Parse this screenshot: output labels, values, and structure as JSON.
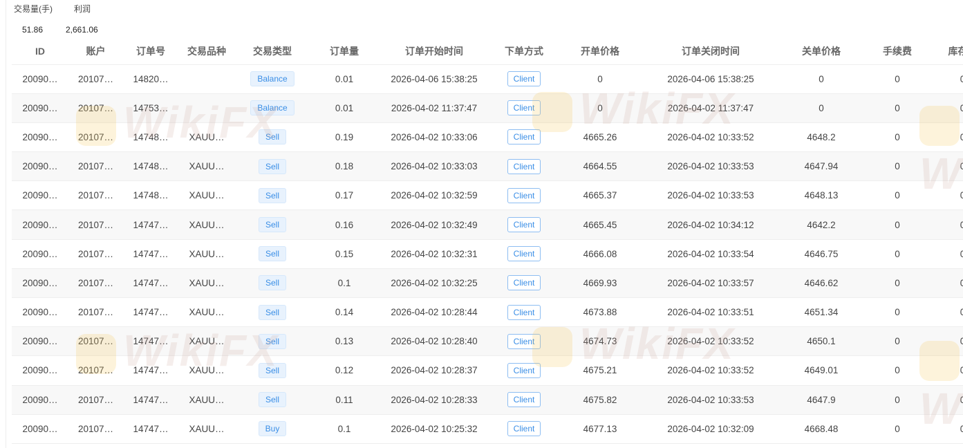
{
  "summary": {
    "labels": [
      "交易量(手)",
      "利润"
    ],
    "values": [
      "51.86",
      "2,661.06"
    ]
  },
  "watermark": "WikiFX",
  "columns": [
    "ID",
    "账户",
    "订单号",
    "交易品种",
    "交易类型",
    "订单量",
    "订单开始时间",
    "下单方式",
    "开单价格",
    "订单关闭时间",
    "关单价格",
    "手续费",
    "库存费"
  ],
  "rows": [
    [
      "20090…",
      "20107…",
      "14820…",
      "",
      "Balance",
      "0.01",
      "2026-04-06 15:38:25",
      "Client",
      "0",
      "2026-04-06 15:38:25",
      "0",
      "0",
      "0"
    ],
    [
      "20090…",
      "20107…",
      "14753…",
      "",
      "Balance",
      "0.01",
      "2026-04-02 11:37:47",
      "Client",
      "0",
      "2026-04-02 11:37:47",
      "0",
      "0",
      "0"
    ],
    [
      "20090…",
      "20107…",
      "14748…",
      "XAUU…",
      "Sell",
      "0.19",
      "2026-04-02 10:33:06",
      "Client",
      "4665.26",
      "2026-04-02 10:33:52",
      "4648.2",
      "0",
      "0"
    ],
    [
      "20090…",
      "20107…",
      "14748…",
      "XAUU…",
      "Sell",
      "0.18",
      "2026-04-02 10:33:03",
      "Client",
      "4664.55",
      "2026-04-02 10:33:53",
      "4647.94",
      "0",
      "0"
    ],
    [
      "20090…",
      "20107…",
      "14748…",
      "XAUU…",
      "Sell",
      "0.17",
      "2026-04-02 10:32:59",
      "Client",
      "4665.37",
      "2026-04-02 10:33:53",
      "4648.13",
      "0",
      "0"
    ],
    [
      "20090…",
      "20107…",
      "14747…",
      "XAUU…",
      "Sell",
      "0.16",
      "2026-04-02 10:32:49",
      "Client",
      "4665.45",
      "2026-04-02 10:34:12",
      "4642.2",
      "0",
      "0"
    ],
    [
      "20090…",
      "20107…",
      "14747…",
      "XAUU…",
      "Sell",
      "0.15",
      "2026-04-02 10:32:31",
      "Client",
      "4666.08",
      "2026-04-02 10:33:54",
      "4646.75",
      "0",
      "0"
    ],
    [
      "20090…",
      "20107…",
      "14747…",
      "XAUU…",
      "Sell",
      "0.1",
      "2026-04-02 10:32:25",
      "Client",
      "4669.93",
      "2026-04-02 10:33:57",
      "4646.62",
      "0",
      "0"
    ],
    [
      "20090…",
      "20107…",
      "14747…",
      "XAUU…",
      "Sell",
      "0.14",
      "2026-04-02 10:28:44",
      "Client",
      "4673.88",
      "2026-04-02 10:33:51",
      "4651.34",
      "0",
      "0"
    ],
    [
      "20090…",
      "20107…",
      "14747…",
      "XAUU…",
      "Sell",
      "0.13",
      "2026-04-02 10:28:40",
      "Client",
      "4674.73",
      "2026-04-02 10:33:52",
      "4650.1",
      "0",
      "0"
    ],
    [
      "20090…",
      "20107…",
      "14747…",
      "XAUU…",
      "Sell",
      "0.12",
      "2026-04-02 10:28:37",
      "Client",
      "4675.21",
      "2026-04-02 10:33:52",
      "4649.01",
      "0",
      "0"
    ],
    [
      "20090…",
      "20107…",
      "14747…",
      "XAUU…",
      "Sell",
      "0.11",
      "2026-04-02 10:28:33",
      "Client",
      "4675.82",
      "2026-04-02 10:33:53",
      "4647.9",
      "0",
      "0"
    ],
    [
      "20090…",
      "20107…",
      "14747…",
      "XAUU…",
      "Buy",
      "0.1",
      "2026-04-02 10:25:32",
      "Client",
      "4677.13",
      "2026-04-02 10:32:09",
      "4668.48",
      "0",
      "0"
    ]
  ]
}
